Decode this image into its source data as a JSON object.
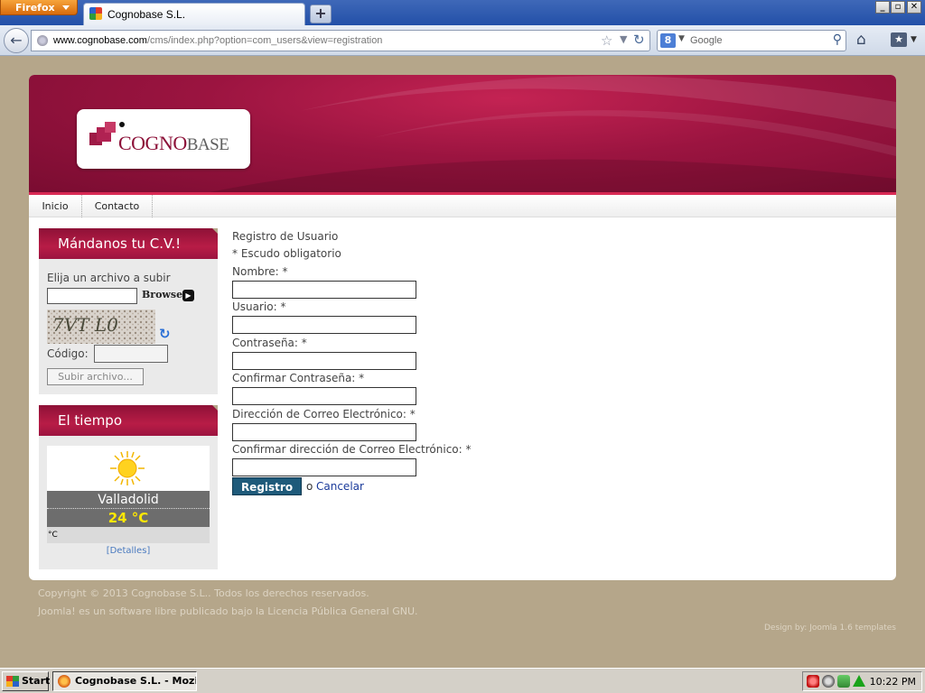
{
  "browser": {
    "menu_button": "Firefox",
    "tab_title": "Cognobase S.L.",
    "new_tab": "+",
    "url_domain": "www.cognobase.com",
    "url_path": "/cms/index.php?option=com_users&view=registration",
    "search_engine": "8",
    "search_placeholder": "Google"
  },
  "window_controls": {
    "minimize": "_",
    "restore": "▫",
    "close": "✕"
  },
  "site": {
    "logo_main": "COGNO",
    "logo_small": "BASE",
    "menu": [
      "Inicio",
      "Contacto"
    ]
  },
  "cv_module": {
    "title": "Mándanos tu C.V.!",
    "file_label": "Elija un archivo a subir",
    "browse": "Browse",
    "captcha_text": "7VT L0",
    "code_label": "Código:",
    "upload": "Subir archivo..."
  },
  "weather_module": {
    "title": "El tiempo",
    "city": "Valladolid",
    "temperature": "24 °C",
    "unit": "°C",
    "details_link": "[Detalles]"
  },
  "registration": {
    "title": "Registro de Usuario",
    "required_note": "* Escudo obligatorio",
    "fields": [
      {
        "label": "Nombre: *"
      },
      {
        "label": "Usuario: *"
      },
      {
        "label": "Contraseña: *"
      },
      {
        "label": "Confirmar Contraseña: *"
      },
      {
        "label": "Dirección de Correo Electrónico: *"
      },
      {
        "label": "Confirmar dirección de Correo Electrónico: *"
      }
    ],
    "submit": "Registro",
    "or": "o",
    "cancel": "Cancelar"
  },
  "footer": {
    "copyright": "Copyright © 2013 Cognobase S.L.. Todos los derechos reservados.",
    "joomla": "Joomla! es un software libre publicado bajo la Licencia Pública General GNU.",
    "design_by": "Design by: Joomla 1.6 templates"
  },
  "taskbar": {
    "start": "Start",
    "task": "Cognobase S.L. - Mozi...",
    "clock": "10:22 PM"
  },
  "colors": {
    "brand": "#9b1440",
    "submit": "#1e5a7a",
    "background": "#b5a68a"
  }
}
